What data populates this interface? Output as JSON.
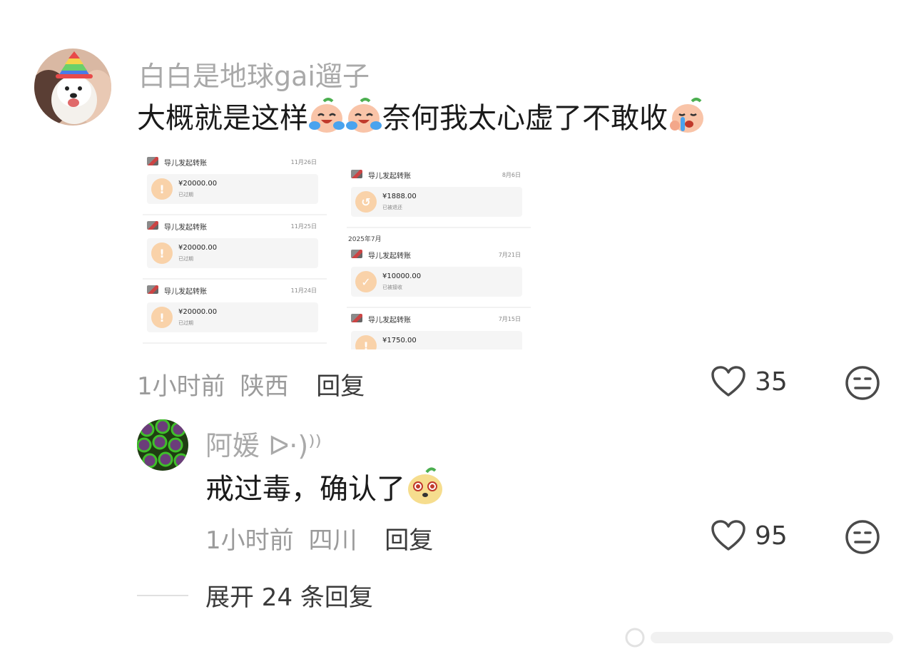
{
  "comment1": {
    "username": "白白是地球gai遛子",
    "text_a": "大概就是这样",
    "text_b": "奈何我太心虚了不敢收",
    "time": "1小时前",
    "location": "陕西",
    "reply_label": "回复",
    "likes": "35",
    "screenshot": {
      "left_cards": [
        {
          "title": "导儿发起转账",
          "date": "11月26日",
          "amount": "¥20000.00",
          "status": "已过期",
          "icon": "warning-icon"
        },
        {
          "title": "导儿发起转账",
          "date": "11月25日",
          "amount": "¥20000.00",
          "status": "已过期",
          "icon": "warning-icon"
        },
        {
          "title": "导儿发起转账",
          "date": "11月24日",
          "amount": "¥20000.00",
          "status": "已过期",
          "icon": "warning-icon"
        }
      ],
      "right_top": {
        "title": "导儿发起转账",
        "date": "8月6日",
        "amount": "¥1888.00",
        "status": "已被退还",
        "icon": "return-icon"
      },
      "month_label": "2025年7月",
      "right_cards": [
        {
          "title": "导儿发起转账",
          "date": "7月21日",
          "amount": "¥10000.00",
          "status": "已被接收",
          "icon": "check-icon"
        },
        {
          "title": "导儿发起转账",
          "date": "7月15日",
          "amount": "¥1750.00",
          "status": "",
          "icon": "warning-icon"
        }
      ]
    }
  },
  "comment2": {
    "username": "阿媛 ᐅ·)⁾⁾",
    "text": "戒过毒，确认了",
    "time": "1小时前",
    "location": "四川",
    "reply_label": "回复",
    "likes": "95"
  },
  "expand_label": "展开 24 条回复",
  "colors": {
    "username": "#a9a9a9",
    "text": "#1a1a1a",
    "meta": "#9b9b9b",
    "icon_stroke": "#4a4a4a"
  }
}
